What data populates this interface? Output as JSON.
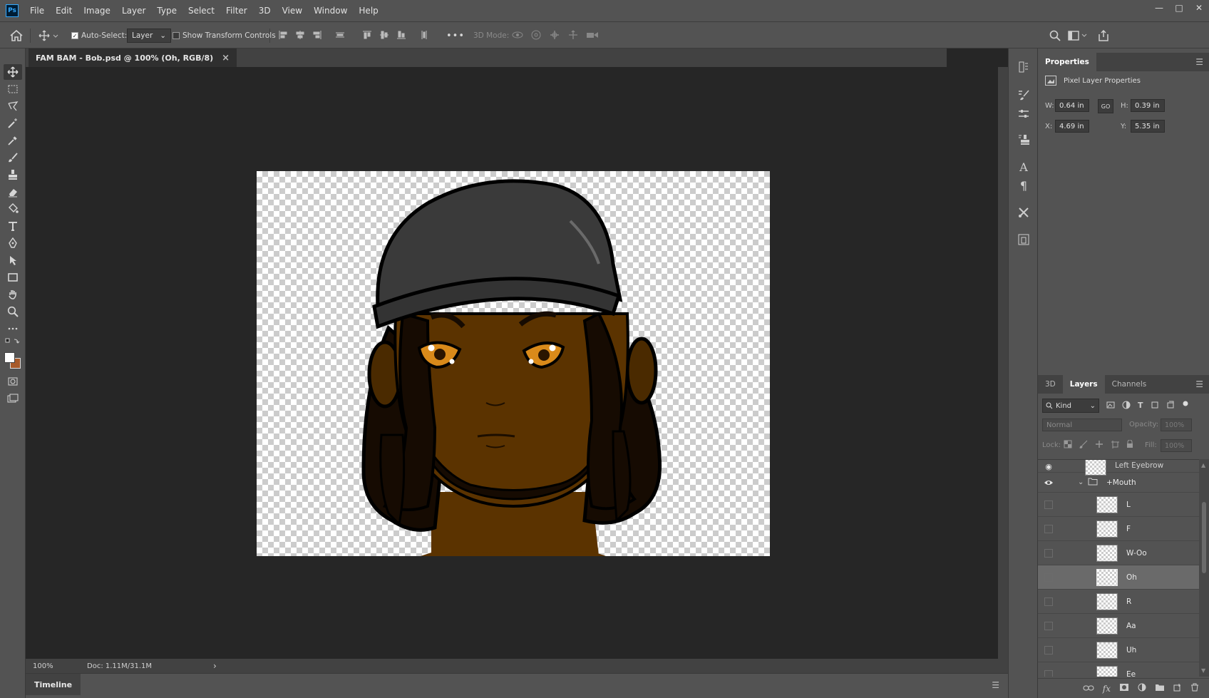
{
  "app": {
    "logo": "Ps"
  },
  "menu": [
    "File",
    "Edit",
    "Image",
    "Layer",
    "Type",
    "Select",
    "Filter",
    "3D",
    "View",
    "Window",
    "Help"
  ],
  "window_controls": [
    "minimize-icon",
    "maximize-icon",
    "close-icon"
  ],
  "options": {
    "auto_select_label": "Auto-Select:",
    "auto_select_target": "Layer",
    "show_transform_label": "Show Transform Controls",
    "three_d_mode_label": "3D Mode:",
    "more_label": "•••"
  },
  "document": {
    "tab_title": "FAM BAM - Bob.psd @ 100% (Oh, RGB/8)",
    "close_glyph": "×"
  },
  "status": {
    "zoom": "100%",
    "doc_size": "Doc: 1.11M/31.1M",
    "arrow": "›"
  },
  "timeline": {
    "tab_label": "Timeline"
  },
  "properties": {
    "tab_label": "Properties",
    "header": "Pixel Layer Properties",
    "w_label": "W:",
    "w_value": "0.64 in",
    "h_label": "H:",
    "h_value": "0.39 in",
    "x_label": "X:",
    "x_value": "4.69 in",
    "y_label": "Y:",
    "y_value": "5.35 in",
    "link_glyph": "GO"
  },
  "layers_panel": {
    "tabs": [
      "3D",
      "Layers",
      "Channels"
    ],
    "active_tab": "Layers",
    "filter_kind": "Kind",
    "blend_mode": "Normal",
    "opacity_label": "Opacity:",
    "opacity_value": "100%",
    "lock_label": "Lock:",
    "fill_label": "Fill:",
    "fill_value": "100%",
    "partial_top_layer": "Left Eyebrow",
    "group_name": "+Mouth",
    "layers": [
      {
        "name": "L",
        "selected": false
      },
      {
        "name": "F",
        "selected": false
      },
      {
        "name": "W-Oo",
        "selected": false
      },
      {
        "name": "Oh",
        "selected": true
      },
      {
        "name": "R",
        "selected": false
      },
      {
        "name": "Aa",
        "selected": false
      },
      {
        "name": "Uh",
        "selected": false
      },
      {
        "name": "Ee",
        "selected": false
      }
    ]
  },
  "colors": {
    "foreground": "#ffffff",
    "background": "#a85a2a",
    "skin": "#5b3300",
    "hair": "#160b02",
    "cap": "#3a3a3a",
    "eye": "#d98a1a"
  }
}
